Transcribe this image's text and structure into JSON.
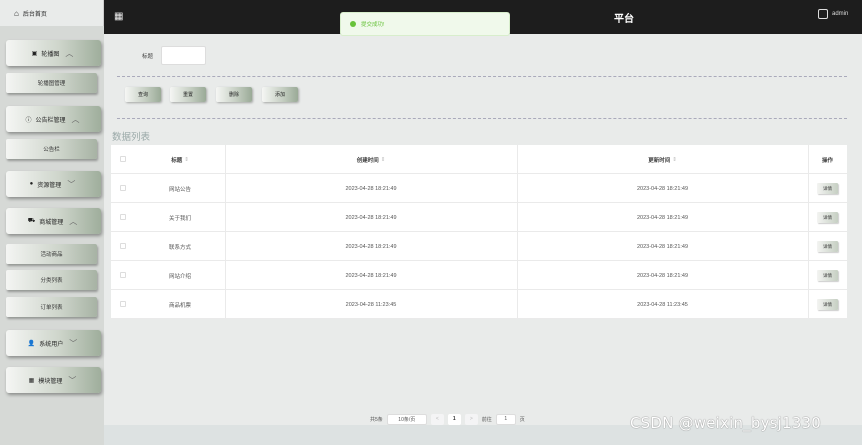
{
  "sidebar": {
    "home_label": "后台首页",
    "menus": [
      {
        "label": "轮播图",
        "icon": "picture-icon",
        "expanded": true
      },
      {
        "label": "公告栏管理",
        "icon": "info-icon",
        "expanded": true
      },
      {
        "label": "资源管理",
        "icon": "location-icon",
        "expanded": false
      },
      {
        "label": "商城管理",
        "icon": "cart-icon",
        "expanded": true
      },
      {
        "label": "系统用户",
        "icon": "user-icon",
        "expanded": false
      },
      {
        "label": "模块管理",
        "icon": "grid-icon",
        "expanded": false
      }
    ],
    "subitems": [
      "轮播图管理",
      "公告栏",
      "活动商品",
      "分类列表",
      "订单列表"
    ]
  },
  "header": {
    "title": "平台",
    "user": "admin"
  },
  "toast": "提交成功!",
  "search": {
    "label": "标题",
    "value": ""
  },
  "actions": [
    "查询",
    "重置",
    "删除",
    "添加"
  ],
  "list_title": "数据列表",
  "table": {
    "headers": [
      "标题",
      "创建时间",
      "更新时间",
      "操作"
    ],
    "sort_mark": "⇕",
    "rows": [
      {
        "title": "网站公告",
        "created": "2023-04-28 18:21:49",
        "updated": "2023-04-28 18:21:49",
        "action": "详情"
      },
      {
        "title": "关于我们",
        "created": "2023-04-28 18:21:49",
        "updated": "2023-04-28 18:21:49",
        "action": "详情"
      },
      {
        "title": "联系方式",
        "created": "2023-04-28 18:21:49",
        "updated": "2023-04-28 18:21:49",
        "action": "详情"
      },
      {
        "title": "网站介绍",
        "created": "2023-04-28 18:21:49",
        "updated": "2023-04-28 18:21:49",
        "action": "详情"
      },
      {
        "title": "商品机票",
        "created": "2023-04-28 11:23:45",
        "updated": "2023-04-28 11:23:45",
        "action": "详情"
      }
    ]
  },
  "pagination": {
    "total": "共5条",
    "page_size": "10条/页",
    "prev": "<",
    "current": "1",
    "next": ">",
    "goto_label": "前往",
    "goto_value": "1",
    "goto_suffix": "页"
  },
  "watermark": "CSDN @weixin_bysj1330"
}
